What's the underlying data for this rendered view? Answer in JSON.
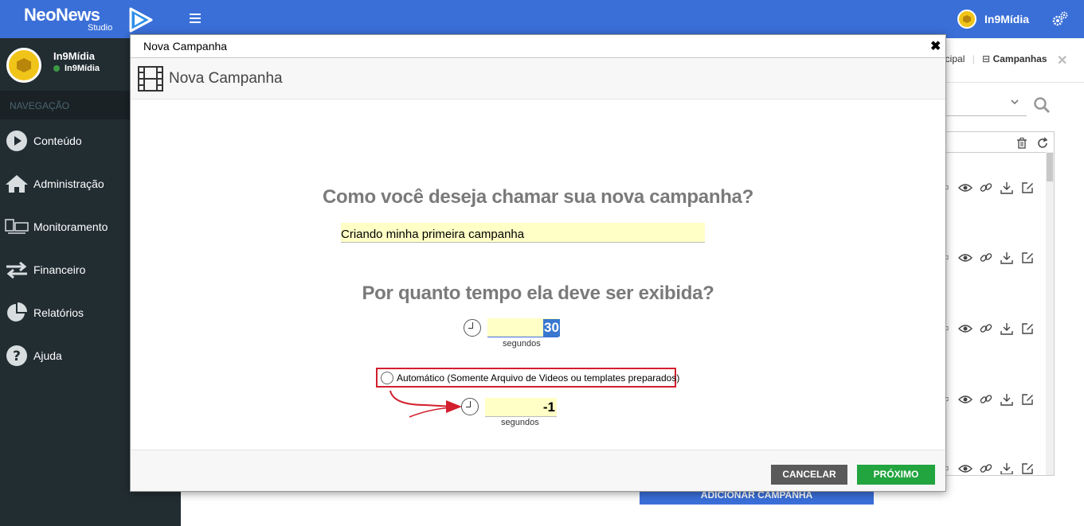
{
  "app": {
    "logo_main": "NeoNews",
    "logo_sub": "Studio",
    "top_user_name": "In9Mídia"
  },
  "sidebar": {
    "user_name": "In9Mídia",
    "user_status": "In9Mídia",
    "nav_header": "NAVEGAÇÃO",
    "items": [
      {
        "label": "Conteúdo",
        "icon": "play-circle-icon"
      },
      {
        "label": "Administração",
        "icon": "home-icon"
      },
      {
        "label": "Monitoramento",
        "icon": "monitor-icon"
      },
      {
        "label": "Financeiro",
        "icon": "exchange-icon"
      },
      {
        "label": "Relatórios",
        "icon": "pie-chart-icon"
      },
      {
        "label": "Ajuda",
        "icon": "question-icon"
      }
    ]
  },
  "background": {
    "breadcrumb_prev": "ncipal",
    "breadcrumb_current": "Campanhas",
    "add_button": "ADICIONAR CAMPANHA"
  },
  "modal": {
    "window_title": "Nova Campanha",
    "header_title": "Nova Campanha",
    "question_name": "Como você deseja chamar sua nova campanha?",
    "name_value": "Criando minha primeira campanha",
    "question_time": "Por quanto tempo ela deve ser exibida?",
    "seconds_value": "30",
    "seconds_label": "segundos",
    "auto_label": "Automático (Somente Arquivo de Videos ou templates preparados)",
    "auto_seconds_value": "-1",
    "auto_seconds_label": "segundos",
    "cancel_label": "CANCELAR",
    "next_label": "PRÓXIMO"
  },
  "colors": {
    "topbar": "#3a6fd8",
    "sidebar": "#222d32",
    "highlight_box": "#d21f2d",
    "next_button": "#22a43f",
    "cancel_button": "#5a5a5a",
    "input_bg": "#ffffc6"
  }
}
